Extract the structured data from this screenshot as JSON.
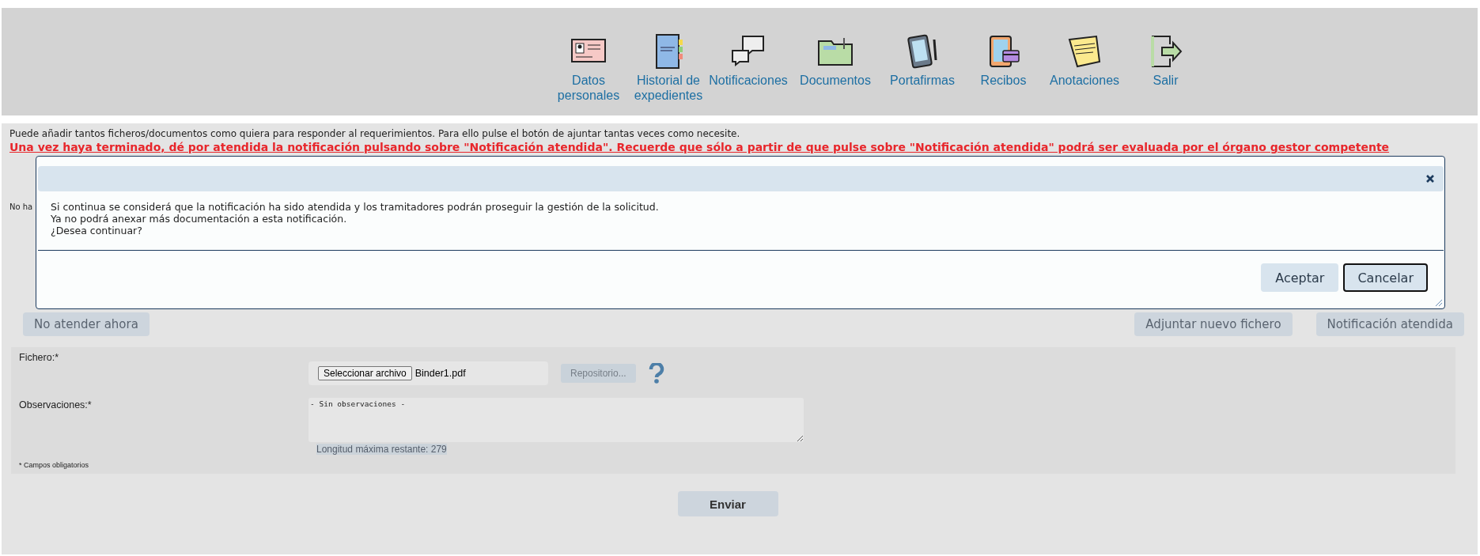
{
  "nav": [
    {
      "label": "Datos personales",
      "kind": "id-card"
    },
    {
      "label": "Historial de expedientes",
      "kind": "binder"
    },
    {
      "label": "Notificaciones",
      "kind": "chat"
    },
    {
      "label": "Documentos",
      "kind": "folder"
    },
    {
      "label": "Portafirmas",
      "kind": "tablet"
    },
    {
      "label": "Recibos",
      "kind": "receipt"
    },
    {
      "label": "Anotaciones",
      "kind": "note"
    },
    {
      "label": "Salir",
      "kind": "exit"
    }
  ],
  "instructions": "Puede añadir tantos ficheros/documentos como quiera para responder al requerimientos. Para ello pulse el botón de ajuntar tantas veces como necesite.",
  "warning": "Una vez haya terminado, dé por atendida la notificación pulsando sobre \"Notificación atendida\". Recuerde que sólo a partir de que pulse sobre \"Notificación atendida\" podrá ser evaluada por el órgano gestor competente",
  "partial_text": "No ha",
  "actions": {
    "left": "No atender ahora",
    "right": [
      "Adjuntar nuevo fichero",
      "Notificación atendida"
    ]
  },
  "form": {
    "file_label": "Fichero:*",
    "file_button": "Seleccionar archivo",
    "file_name": "Binder1.pdf",
    "repository_button": "Repositorio...",
    "notes_label": "Observaciones:*",
    "notes_value": "- Sin observaciones -",
    "remaining": "Longitud máxima restante: 279",
    "required_note": "* Campos obligatorios"
  },
  "submit": "Enviar",
  "dialog": {
    "lines": [
      "Si continua se considerá que la notificación ha sido atendida y los tramitadores podrán proseguir la gestión de la solicitud.",
      "Ya no podrá anexar más documentación a esta notificación.",
      "¿Desea continuar?"
    ],
    "buttons": [
      {
        "label": "Aceptar",
        "focused": false
      },
      {
        "label": "Cancelar",
        "focused": true
      }
    ]
  }
}
